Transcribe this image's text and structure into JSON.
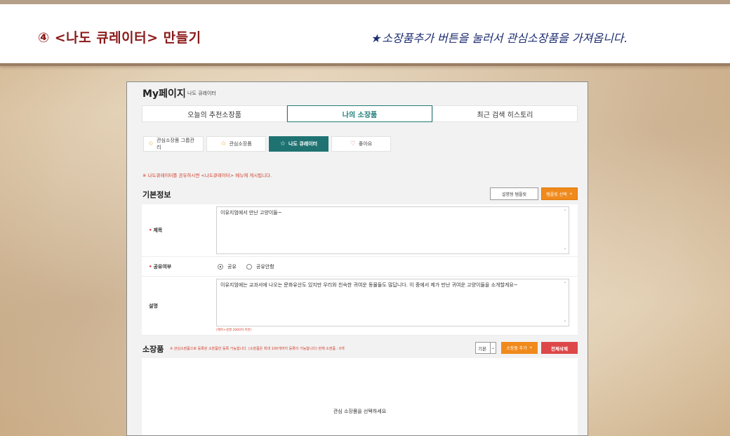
{
  "banner": {
    "step_title": "④ <나도 큐레이터> 만들기",
    "hint_star": "★",
    "hint_text": "소장품추가 버튼을 눌러서 관심소장품을 가져옵니다."
  },
  "mypage": {
    "title": "My페이지",
    "subtitle": "나도 큐레이터"
  },
  "tabs": [
    {
      "label": "오늘의 추천소장품"
    },
    {
      "label": "나의 소장품"
    },
    {
      "label": "최근 검색 히스토리"
    }
  ],
  "subtabs": [
    {
      "label": "관심소장품 그룹관리",
      "icon": "☆"
    },
    {
      "label": "관심소장품",
      "icon": "☆"
    },
    {
      "label": "나도 큐레이터",
      "icon": "☆"
    },
    {
      "label": "좋아요",
      "icon": "♡"
    }
  ],
  "notice": "※ 나도큐레이터를 공유하시면 <나도큐레이터> 메뉴에 게시됩니다.",
  "basic_info": {
    "section_title": "기본정보",
    "template_button": "설명형 템플릿",
    "template_select_button": "템플릿 선택",
    "plus": "+",
    "title_label": "제목",
    "title_value": "이유지엄에서 만난 고양이들~",
    "share_label": "공유여부",
    "share_on": "공유",
    "share_off": "공유안함",
    "desc_label": "설명",
    "desc_value": "이유지엄에는 교과서에 나오는 문화유산도 있지만 우리와 친숙한 귀여운 동물들도 많답니다. 이 중에서 제가 만난 귀여운 고양이들을 소개할게요~",
    "counter": "(제목+설명 2000자 미만)",
    "required_mark": "•"
  },
  "collection": {
    "section_title": "소장품",
    "note": "※ 관심소장품으로 등록된 소장품만 등록 가능합니다.    (소장품은 최대 100개까지 등록이 가능합니다)    현재 소장품 : 0개",
    "sort_value": "기본",
    "add_button": "소장품 추가",
    "delete_all_button": "전체삭제",
    "empty_message": "관심 소장품을 선택하세요"
  }
}
